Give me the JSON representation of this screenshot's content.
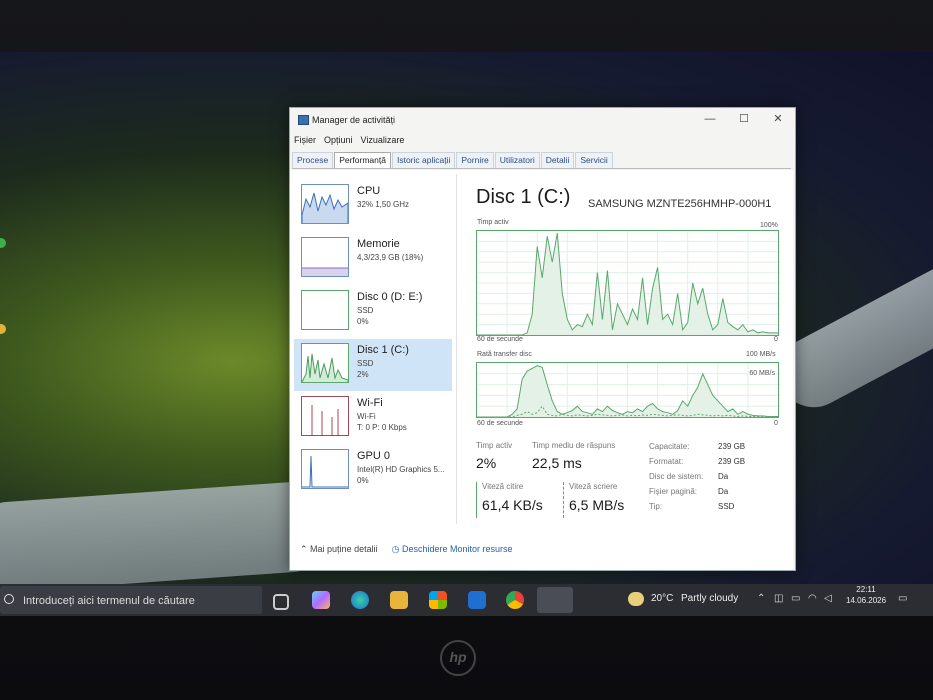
{
  "window": {
    "title": "Manager de activități",
    "controls": {
      "minimize": "—",
      "maximize": "☐",
      "close": "✕"
    }
  },
  "menu": [
    "Fișier",
    "Opțiuni",
    "Vizualizare"
  ],
  "tabs": [
    {
      "label": "Procese",
      "active": false
    },
    {
      "label": "Performanță",
      "active": true
    },
    {
      "label": "Istoric aplicații",
      "active": false
    },
    {
      "label": "Pornire",
      "active": false
    },
    {
      "label": "Utilizatori",
      "active": false
    },
    {
      "label": "Detalii",
      "active": false
    },
    {
      "label": "Servicii",
      "active": false
    }
  ],
  "perf_list": [
    {
      "name": "CPU",
      "sub1": "32%  1,50 GHz",
      "sub2": ""
    },
    {
      "name": "Memorie",
      "sub1": "4,3/23,9 GB (18%)",
      "sub2": ""
    },
    {
      "name": "Disc 0 (D: E:)",
      "sub1": "SSD",
      "sub2": "0%"
    },
    {
      "name": "Disc 1 (C:)",
      "sub1": "SSD",
      "sub2": "2%"
    },
    {
      "name": "Wi-Fi",
      "sub1": "Wi-Fi",
      "sub2": "T: 0  P: 0 Kbps"
    },
    {
      "name": "GPU 0",
      "sub1": "Intel(R) HD Graphics 5...",
      "sub2": "0%"
    }
  ],
  "detail": {
    "title": "Disc 1 (C:)",
    "model": "SAMSUNG MZNTE256HMHP-000H1",
    "chart1": {
      "label": "Timp activ",
      "max": "100%",
      "time": "60 de secunde",
      "min": "0"
    },
    "chart2": {
      "label": "Rată transfer disc",
      "max": "100 MB/s",
      "mid": "60 MB/s",
      "time": "60 de secunde",
      "min": "0"
    },
    "stats": {
      "active_time_label": "Timp activ",
      "active_time": "2%",
      "avg_response_label": "Timp mediu de răspuns",
      "avg_response": "22,5 ms",
      "read_speed_label": "Viteză citire",
      "read_speed": "61,4 KB/s",
      "write_speed_label": "Viteză scriere",
      "write_speed": "6,5 MB/s"
    },
    "properties": [
      {
        "key": "Capacitate:",
        "value": "239 GB"
      },
      {
        "key": "Formatat:",
        "value": "239 GB"
      },
      {
        "key": "Disc de sistem:",
        "value": "Da"
      },
      {
        "key": "Fișier pagină:",
        "value": "Da"
      },
      {
        "key": "Tip:",
        "value": "SSD"
      }
    ]
  },
  "footer": {
    "fewer": "Mai puține detalii",
    "monitor": "Deschidere Monitor resurse"
  },
  "taskbar": {
    "search_placeholder": "Introduceți aici termenul de căutare",
    "weather_temp": "20°C",
    "weather_desc": "Partly cloudy",
    "time": "22:11",
    "date": "14.06.2026"
  },
  "brand": "hp",
  "chart_data": [
    {
      "type": "area",
      "title": "Timp activ",
      "ylim": [
        0,
        100
      ],
      "x": [
        0,
        1,
        2,
        3,
        4,
        5,
        6,
        7,
        8,
        9,
        10,
        11,
        12,
        13,
        14,
        15,
        16,
        17,
        18,
        19,
        20,
        21,
        22,
        23,
        24,
        25,
        26,
        27,
        28,
        29,
        30,
        31,
        32,
        33,
        34,
        35,
        36,
        37,
        38,
        39,
        40,
        41,
        42,
        43,
        44,
        45,
        46,
        47,
        48,
        49,
        50,
        51,
        52,
        53,
        54,
        55,
        56,
        57,
        58,
        59,
        60
      ],
      "series": [
        {
          "values": [
            0,
            0,
            0,
            0,
            0,
            0,
            0,
            0,
            0,
            0,
            2,
            20,
            85,
            55,
            95,
            70,
            98,
            40,
            15,
            5,
            10,
            8,
            20,
            10,
            60,
            15,
            62,
            5,
            30,
            20,
            10,
            25,
            15,
            55,
            10,
            45,
            65,
            15,
            20,
            10,
            40,
            5,
            12,
            50,
            30,
            45,
            20,
            5,
            10,
            35,
            12,
            8,
            5,
            10,
            3,
            5,
            2,
            3,
            2,
            2,
            2
          ]
        }
      ]
    },
    {
      "type": "area",
      "title": "Rată transfer disc",
      "ylim": [
        0,
        100
      ],
      "x": [
        0,
        1,
        2,
        3,
        4,
        5,
        6,
        7,
        8,
        9,
        10,
        11,
        12,
        13,
        14,
        15,
        16,
        17,
        18,
        19,
        20,
        21,
        22,
        23,
        24,
        25,
        26,
        27,
        28,
        29,
        30,
        31,
        32,
        33,
        34,
        35,
        36,
        37,
        38,
        39,
        40,
        41,
        42,
        43,
        44,
        45,
        46,
        47,
        48,
        49,
        50,
        51,
        52,
        53,
        54,
        55,
        56,
        57,
        58,
        59,
        60
      ],
      "series": [
        {
          "values": [
            0,
            0,
            0,
            0,
            0,
            0,
            0,
            5,
            15,
            70,
            85,
            90,
            95,
            92,
            60,
            30,
            10,
            5,
            8,
            12,
            20,
            10,
            8,
            5,
            15,
            10,
            20,
            12,
            8,
            5,
            10,
            8,
            15,
            10,
            20,
            25,
            15,
            10,
            8,
            5,
            12,
            30,
            20,
            40,
            55,
            80,
            60,
            40,
            30,
            20,
            10,
            15,
            5,
            10,
            5,
            3,
            2,
            2,
            1,
            1,
            1
          ]
        },
        {
          "values": [
            0,
            0,
            0,
            0,
            0,
            0,
            0,
            0,
            3,
            5,
            10,
            5,
            8,
            20,
            5,
            3,
            2,
            5,
            3,
            2,
            4,
            3,
            2,
            3,
            5,
            4,
            3,
            2,
            3,
            4,
            2,
            3,
            2,
            4,
            3,
            5,
            4,
            3,
            2,
            3,
            4,
            3,
            2,
            3,
            5,
            4,
            3,
            2,
            3,
            2,
            3,
            2,
            1,
            2,
            1,
            1,
            1,
            1,
            0,
            0,
            0
          ]
        }
      ]
    }
  ]
}
